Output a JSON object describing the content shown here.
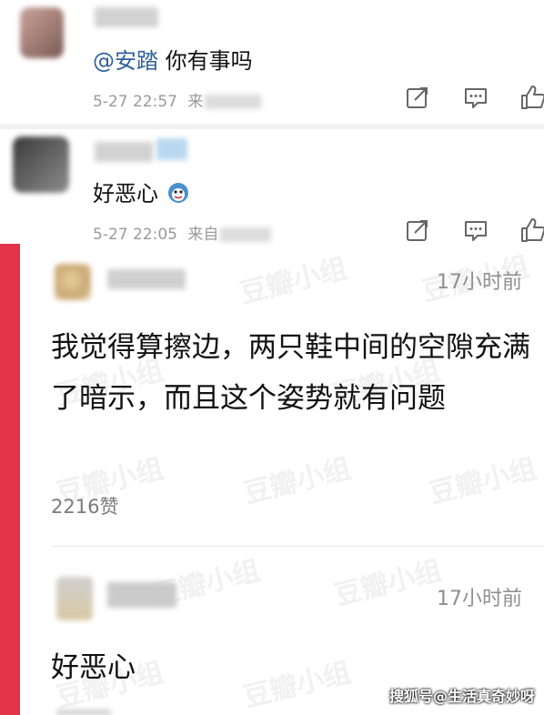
{
  "weibo_comments": [
    {
      "mention": "@安踏",
      "text": " 你有事吗",
      "timestamp": "5-27 22:57",
      "source_prefix": "来"
    },
    {
      "text": "好恶心",
      "emoji": "emoji-face-icon",
      "timestamp": "5-27 22:05",
      "source_prefix": "来自"
    }
  ],
  "douban_comments": [
    {
      "time": "17小时前",
      "body": "我觉得算擦边，两只鞋中间的空隙充满了暗示，而且这个姿势就有问题",
      "likes": "2216赞"
    },
    {
      "time": "17小时前",
      "body": "好恶心"
    }
  ],
  "watermark": "豆瓣小组",
  "footer_watermark": "搜狐号@生活真奇妙呀",
  "colors": {
    "accent_bar": "#e3354a",
    "mention": "#2e5f9e"
  }
}
